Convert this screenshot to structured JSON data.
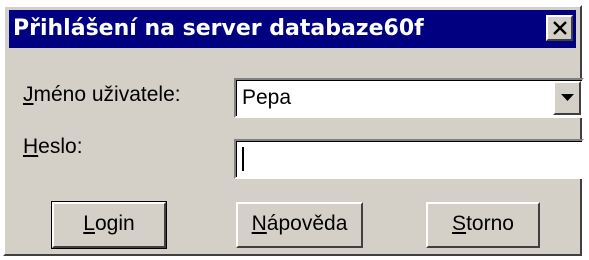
{
  "dialog": {
    "title": "Přihlášení na server databaze60f",
    "close_label": "×"
  },
  "form": {
    "username": {
      "label_accel": "J",
      "label_rest": "méno uživatele:",
      "value": "Pepa"
    },
    "password": {
      "label_accel": "H",
      "label_rest": "eslo:",
      "value": ""
    }
  },
  "buttons": {
    "login": {
      "accel": "L",
      "rest": "ogin"
    },
    "help": {
      "accel": "N",
      "rest": "ápověda"
    },
    "cancel": {
      "accel": "S",
      "rest": "torno"
    }
  },
  "colors": {
    "titlebar": "#000080",
    "face": "#d4d0c8"
  },
  "icons": {
    "close": "close-icon",
    "dropdown": "chevron-down-icon"
  }
}
